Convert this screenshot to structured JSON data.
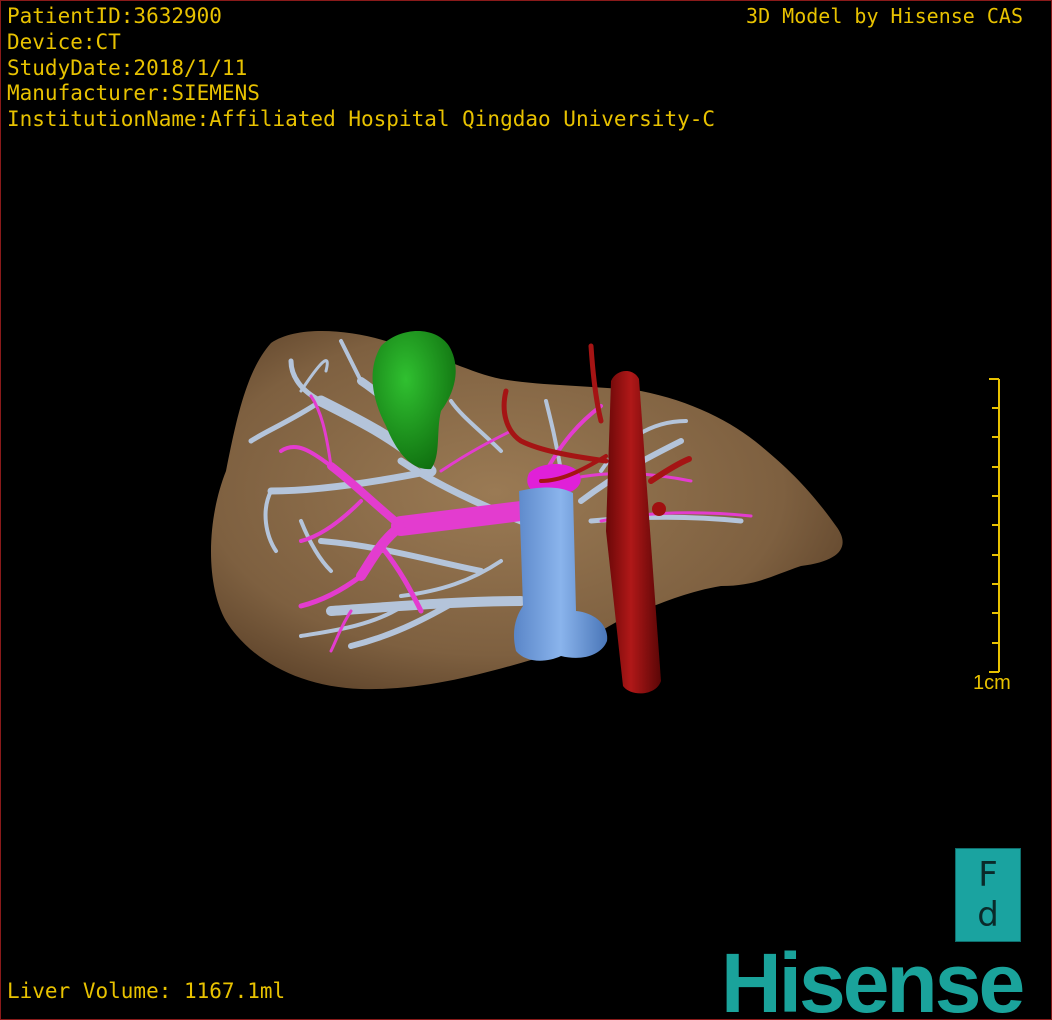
{
  "header": {
    "patient_id": "PatientID:3632900",
    "device": "Device:CT",
    "study_date": "StudyDate:2018/1/11",
    "manufacturer": "Manufacturer:SIEMENS",
    "institution": "InstitutionName:Affiliated Hospital Qingdao University-C"
  },
  "brand_caption": "3D Model by Hisense CAS",
  "liver_volume": "Liver Volume: 1167.1ml",
  "scale_bar": {
    "label": "1cm"
  },
  "orientation": {
    "top": "F",
    "bottom": "d"
  },
  "logo": "Hisense",
  "colors": {
    "text": "#e8c200",
    "liver": "#8a6a46",
    "gallbladder": "#1f9a1f",
    "hepatic_vein": "#b8c8dc",
    "portal_vein": "#e040d0",
    "ivc": "#6a9be0",
    "aorta": "#a01010",
    "brand": "#1aa39b"
  }
}
